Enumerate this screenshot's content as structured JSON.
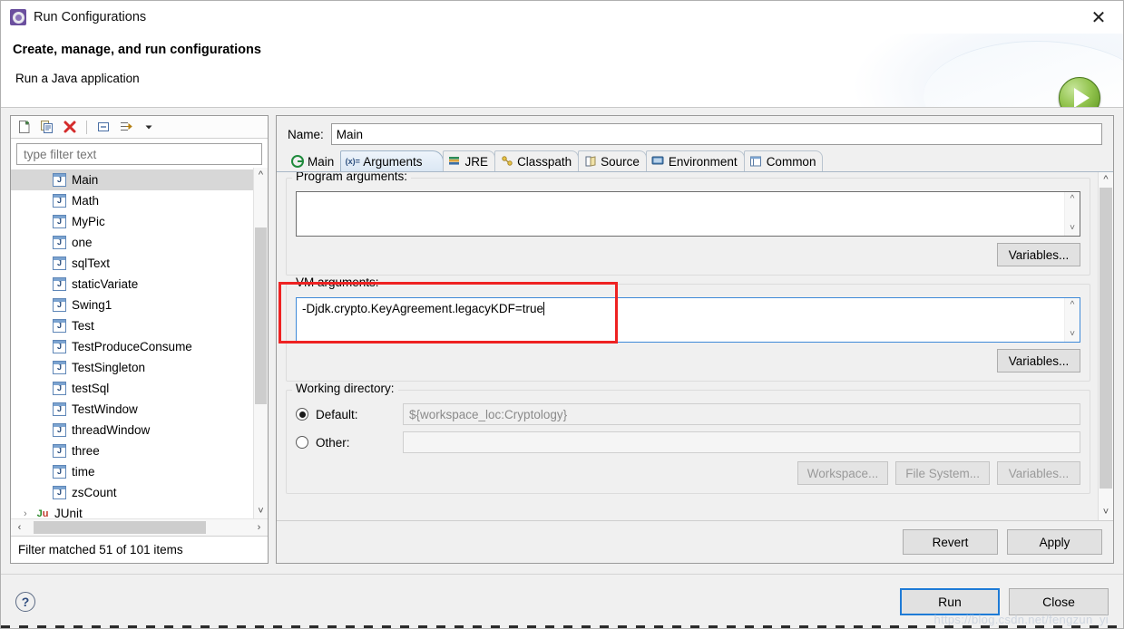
{
  "window": {
    "title": "Run Configurations",
    "icon": "run-configurations-icon",
    "close_label": "✕"
  },
  "header": {
    "title": "Create, manage, and run configurations",
    "subtitle": "Run a Java application",
    "badge_icon": "green-run-play-icon"
  },
  "tree_panel": {
    "toolbar": [
      {
        "name": "new-configuration-icon",
        "glyph": "new"
      },
      {
        "name": "duplicate-configuration-icon",
        "glyph": "copy"
      },
      {
        "name": "delete-configuration-icon",
        "glyph": "delete"
      },
      {
        "name": "collapse-all-icon",
        "glyph": "collapse"
      },
      {
        "name": "filter-icon",
        "glyph": "filter"
      },
      {
        "name": "view-menu-chevron-icon",
        "glyph": "chevron"
      }
    ],
    "filter": {
      "placeholder": "type filter text",
      "value": ""
    },
    "items": [
      {
        "label": "Main",
        "icon": "java-class-icon",
        "selected": true
      },
      {
        "label": "Math",
        "icon": "java-class-icon",
        "selected": false
      },
      {
        "label": "MyPic",
        "icon": "java-class-icon",
        "selected": false
      },
      {
        "label": "one",
        "icon": "java-class-icon",
        "selected": false
      },
      {
        "label": "sqlText",
        "icon": "java-class-icon",
        "selected": false
      },
      {
        "label": "staticVariate",
        "icon": "java-class-icon",
        "selected": false
      },
      {
        "label": "Swing1",
        "icon": "java-class-icon",
        "selected": false
      },
      {
        "label": "Test",
        "icon": "java-class-icon",
        "selected": false
      },
      {
        "label": "TestProduceConsume",
        "icon": "java-class-icon",
        "selected": false
      },
      {
        "label": "TestSingleton",
        "icon": "java-class-icon",
        "selected": false
      },
      {
        "label": "testSql",
        "icon": "java-class-icon",
        "selected": false
      },
      {
        "label": "TestWindow",
        "icon": "java-class-icon",
        "selected": false
      },
      {
        "label": "threadWindow",
        "icon": "java-class-icon",
        "selected": false
      },
      {
        "label": "three",
        "icon": "java-class-icon",
        "selected": false
      },
      {
        "label": "time",
        "icon": "java-class-icon",
        "selected": false
      },
      {
        "label": "zsCount",
        "icon": "java-class-icon",
        "selected": false
      }
    ],
    "root_item": {
      "label": "JUnit",
      "icon": "junit-icon",
      "twisty": "›"
    },
    "status": "Filter matched 51 of 101 items"
  },
  "config": {
    "name_label": "Name:",
    "name_value": "Main",
    "tabs": [
      {
        "label": "Main",
        "icon": "main-tab-icon",
        "active": false
      },
      {
        "label": "Arguments",
        "icon": "arguments-tab-icon",
        "active": true
      },
      {
        "label": "JRE",
        "icon": "jre-tab-icon",
        "active": false
      },
      {
        "label": "Classpath",
        "icon": "classpath-tab-icon",
        "active": false
      },
      {
        "label": "Source",
        "icon": "source-tab-icon",
        "active": false
      },
      {
        "label": "Environment",
        "icon": "environment-tab-icon",
        "active": false
      },
      {
        "label": "Common",
        "icon": "common-tab-icon",
        "active": false
      }
    ],
    "program_arguments": {
      "legend": "Program arguments:",
      "value": "",
      "variables_button": "Variables..."
    },
    "vm_arguments": {
      "legend": "VM arguments:",
      "value": "-Djdk.crypto.KeyAgreement.legacyKDF=true",
      "variables_button": "Variables...",
      "highlight_color": "#ee2222"
    },
    "working_directory": {
      "legend": "Working directory:",
      "default_label": "Default:",
      "default_value": "${workspace_loc:Cryptology}",
      "default_selected": true,
      "other_label": "Other:",
      "other_value": "",
      "other_selected": false,
      "buttons": [
        {
          "label": "Workspace...",
          "enabled": false
        },
        {
          "label": "File System...",
          "enabled": false
        },
        {
          "label": "Variables...",
          "enabled": false
        }
      ]
    },
    "apply_bar": {
      "revert": "Revert",
      "apply": "Apply"
    }
  },
  "footer": {
    "help_icon": "help-question-icon",
    "help_glyph": "?",
    "run_button": "Run",
    "close_button": "Close",
    "watermark": "https://blog.csdn.net/fengzun_yi"
  }
}
